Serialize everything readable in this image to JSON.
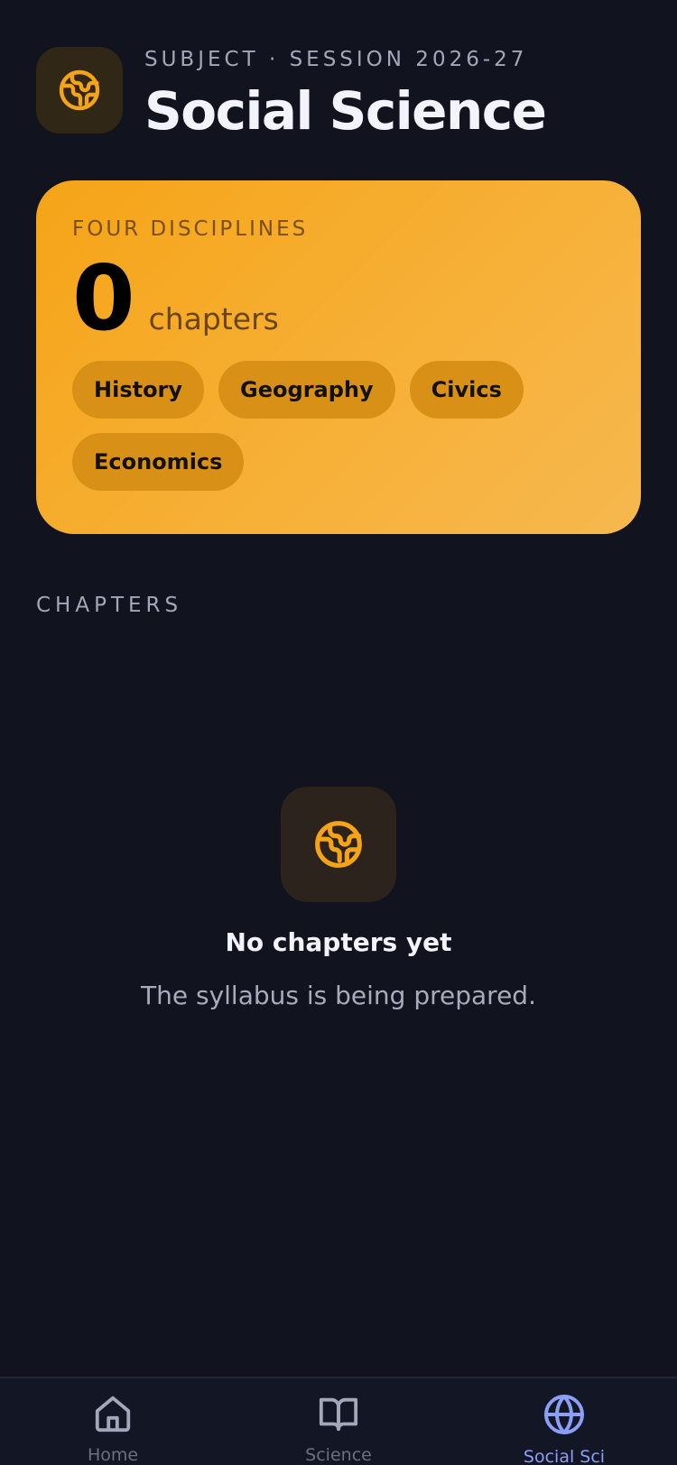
{
  "header": {
    "eyebrow": "SUBJECT · SESSION 2026-27",
    "title": "Social Science",
    "icon": "globe-icon"
  },
  "hero": {
    "eyebrow": "FOUR DISCIPLINES",
    "count": "0",
    "unit": "chapters",
    "chips": [
      "History",
      "Geography",
      "Civics",
      "Economics"
    ],
    "accent": "#f5a417"
  },
  "chapters": {
    "section_label": "CHAPTERS",
    "empty_icon": "globe-icon",
    "empty_title": "No chapters yet",
    "empty_subtitle": "The syllabus is being prepared."
  },
  "nav": {
    "items": [
      {
        "label": "Home",
        "icon": "home-icon"
      },
      {
        "label": "Science",
        "icon": "book-icon"
      },
      {
        "label": "Social Sci",
        "icon": "globe-icon"
      }
    ],
    "active_color": "#8c9ef5"
  }
}
